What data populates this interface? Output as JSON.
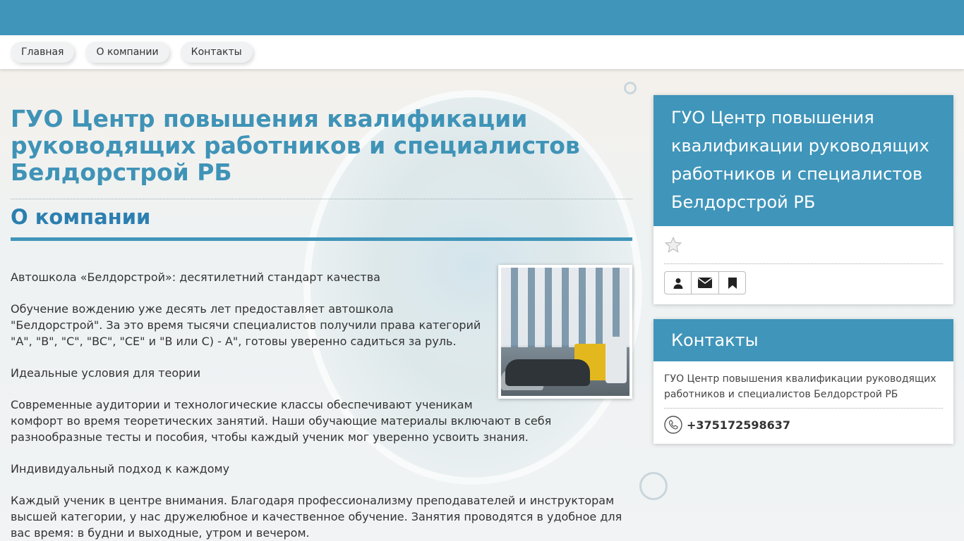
{
  "nav": {
    "items": [
      {
        "label": "Главная"
      },
      {
        "label": "О компании"
      },
      {
        "label": "Контакты"
      }
    ]
  },
  "main": {
    "title": "ГУО Центр повышения квалификации руководящих работников и специалистов Белдорстрой РБ",
    "section_title": "О компании",
    "paragraphs": [
      "Автошкола «Белдорстрой»: десятилетний стандарт качества",
      "Обучение вождению уже десять лет предоставляет автошкола \"Белдорстрой\". За это время тысячи специалистов получили права категорий \"A\", \"B\", \"C\", \"BC\", \"CE\" и \"B или C) - A\", готовы уверенно садиться за руль.",
      "Идеальные условия для теории",
      "Современные аудитории и технологические классы обеспечивают ученикам комфорт во время теоретических занятий. Наши обучающие материалы включают в себя разнообразные тесты и пособия, чтобы каждый ученик мог уверенно усвоить знания.",
      "Индивидуальный подход к каждому",
      "Каждый ученик в центре внимания. Благодаря профессионализму преподавателей и инструкторам высшей категории, у нас дружелюбное и качественное обучение. Занятия проводятся в удобное для вас время: в будни и выходные, утром и вечером."
    ]
  },
  "sidebar": {
    "company_panel": {
      "title": "ГУО Центр повышения квалификации руководящих работников и специалистов Белдорстрой РБ",
      "icons": [
        "star-icon",
        "user-icon",
        "envelope-icon",
        "bookmark-icon"
      ]
    },
    "contacts_panel": {
      "title": "Контакты",
      "org_name": "ГУО Центр повышения квалификации руководящих работников и специалистов Белдорстрой РБ",
      "phone": "+375172598637"
    }
  },
  "colors": {
    "brand": "#4095ba",
    "title": "#3f93b7",
    "section": "#2c7fb0"
  }
}
